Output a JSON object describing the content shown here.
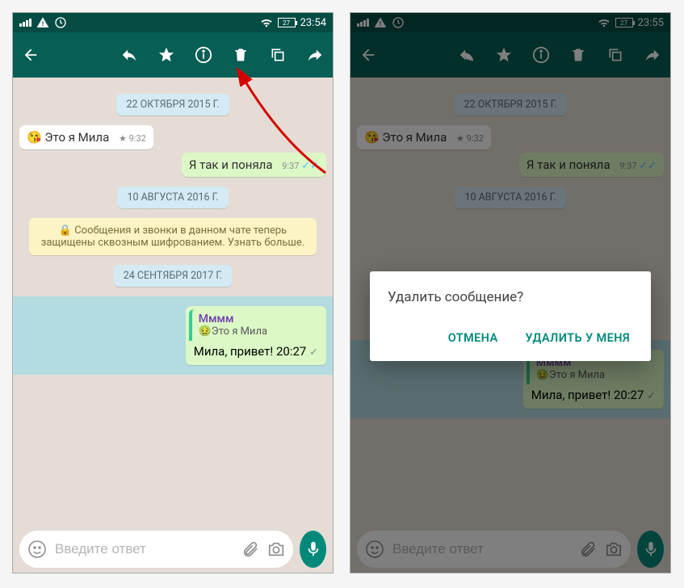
{
  "status": {
    "battery_left": "27",
    "time_left": "23:54",
    "battery_right": "27",
    "time_right": "23:55"
  },
  "dates": {
    "d1": "22 ОКТЯБРЯ 2015 Г.",
    "d2": "10 АВГУСТА 2016 Г.",
    "d3": "24 СЕНТЯБРЯ 2017 Г."
  },
  "messages": {
    "m1_text": "Это я Мила",
    "m1_time": "9:32",
    "m2_text": "Я так и поняла",
    "m2_time": "9:37",
    "quoted_name": "Мммм",
    "quoted_text": "Это я Мила",
    "reply_text": "Мила, привет!",
    "reply_time": "20:27"
  },
  "info": {
    "encryption": "Сообщения и звонки в данном чате теперь защищены сквозным шифрованием. Узнать больше."
  },
  "input": {
    "placeholder": "Введите ответ"
  },
  "dialog": {
    "title": "Удалить сообщение?",
    "cancel": "ОТМЕНА",
    "delete": "УДАЛИТЬ У МЕНЯ"
  }
}
